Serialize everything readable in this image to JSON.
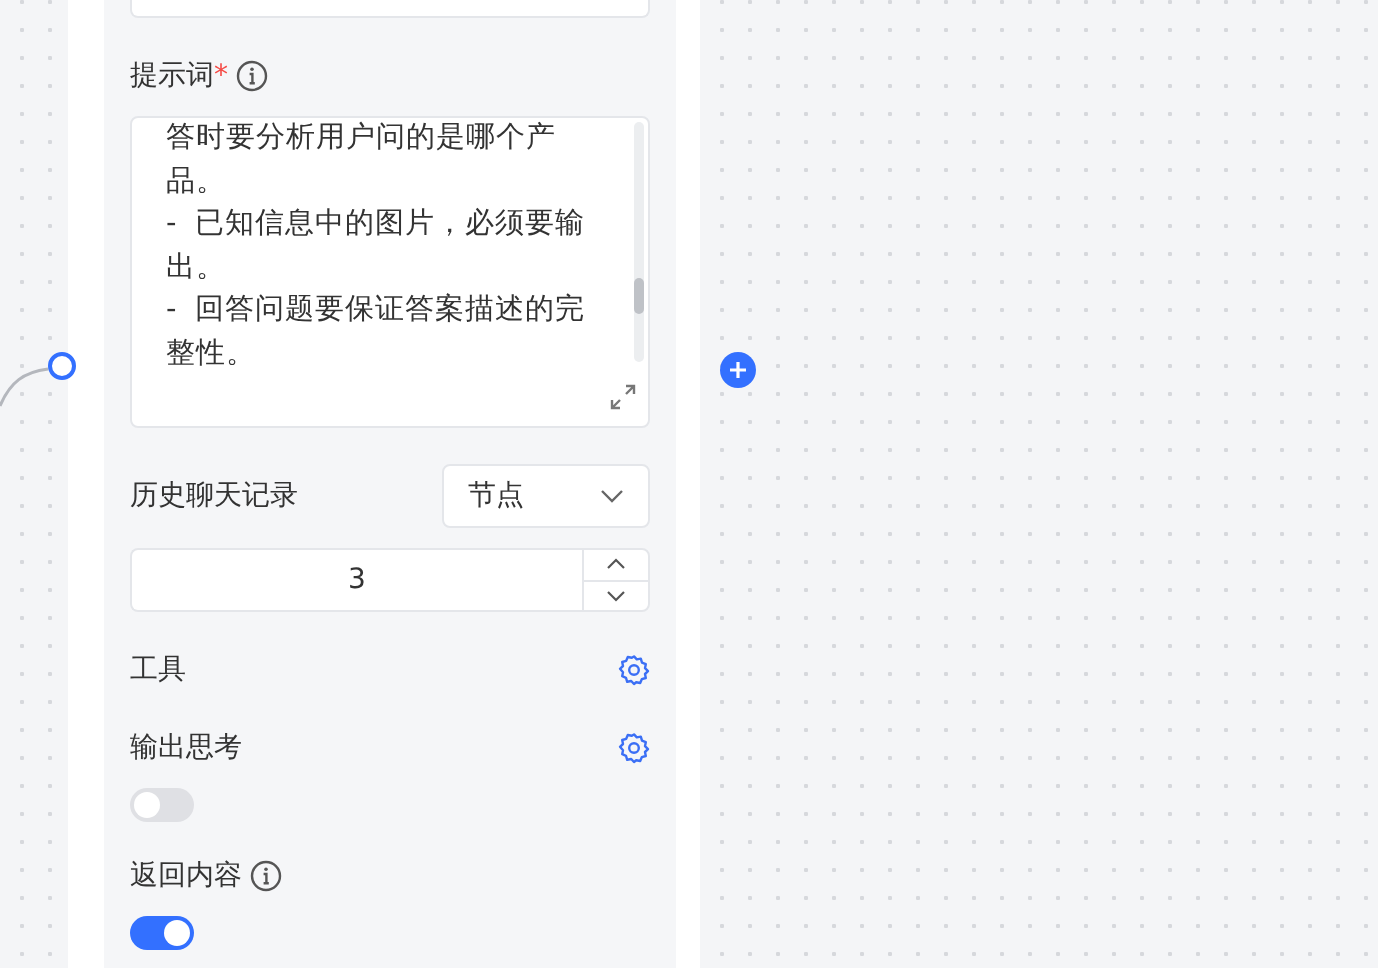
{
  "prompt": {
    "label": "提示词",
    "required_mark": "*",
    "value": "答时要分析用户问的是哪个产品。\n-  已知信息中的图片，必须要输出。\n-  回答问题要保证答案描述的完整性。"
  },
  "history": {
    "label": "历史聊天记录",
    "select": "节点",
    "count": "3"
  },
  "rows": [
    {
      "kind": "gear",
      "label": "工具"
    },
    {
      "kind": "gear-toggle",
      "label": "输出思考",
      "on": false
    },
    {
      "kind": "info-toggle",
      "label": "返回内容",
      "on": true
    }
  ]
}
